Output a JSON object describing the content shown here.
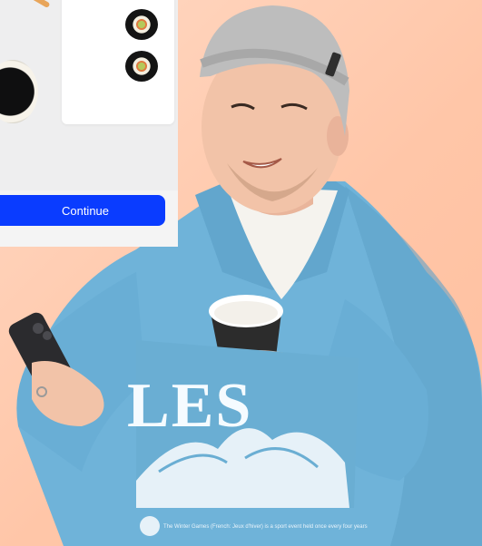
{
  "card": {
    "continue_label": "Continue"
  },
  "sweatshirt": {
    "headline": "LES",
    "fine_print": "The Winter Games (French: Jeux d'hiver) is a sport event held once every four years"
  },
  "colors": {
    "background": "#ffc6a8",
    "button": "#0a3cff",
    "sweatshirt": "#6fb3d9",
    "beanie": "#bdbdbd"
  },
  "icons": {
    "product_image": "sushi-plate-image",
    "person": "person-with-phone-and-coffee"
  }
}
